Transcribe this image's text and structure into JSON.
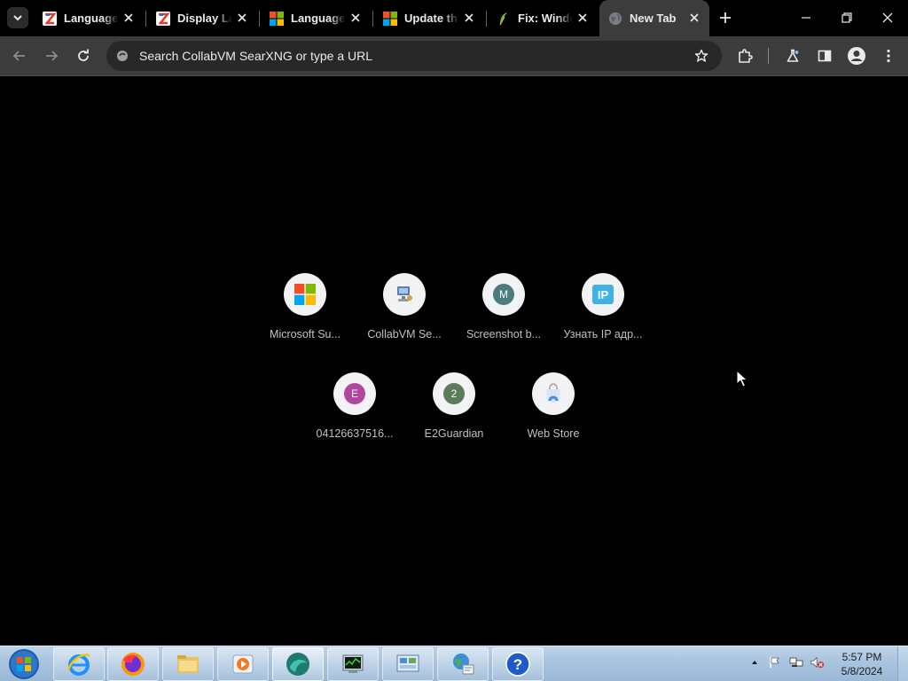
{
  "browser": {
    "tabs": [
      {
        "title": "Language",
        "icon": "zscaler-icon",
        "active": false
      },
      {
        "title": "Display La",
        "icon": "zscaler-icon",
        "active": false
      },
      {
        "title": "Language",
        "icon": "microsoft-icon",
        "active": false
      },
      {
        "title": "Update th",
        "icon": "microsoft-icon",
        "active": false
      },
      {
        "title": "Fix: Windo",
        "icon": "feather-icon",
        "active": false
      },
      {
        "title": "New Tab",
        "icon": "globe-icon",
        "active": true
      }
    ],
    "omnibox": {
      "placeholder": "Search CollabVM SearXNG or type a URL"
    }
  },
  "shortcuts": [
    {
      "label": "Microsoft Su...",
      "icon": "microsoft-logo-icon"
    },
    {
      "label": "CollabVM Se...",
      "icon": "collabvm-icon"
    },
    {
      "label": "Screenshot b...",
      "icon": "letter-m-icon",
      "letter": "M",
      "color": "#4a7c7e"
    },
    {
      "label": "Узнать IP адр...",
      "icon": "ip-icon",
      "letter": "IP",
      "color": "#3fb3e6"
    },
    {
      "label": "04126637516...",
      "icon": "letter-e-icon",
      "letter": "E",
      "color": "#b0479c"
    },
    {
      "label": "E2Guardian",
      "icon": "letter-2-icon",
      "letter": "2",
      "color": "#5c7a5c"
    },
    {
      "label": "Web Store",
      "icon": "web-store-icon"
    }
  ],
  "taskbar": {
    "apps": [
      "internet-explorer-icon",
      "firefox-icon",
      "file-explorer-icon",
      "media-player-icon",
      "chrome-like-icon",
      "task-manager-icon",
      "network-icon",
      "network-globe-icon",
      "help-icon"
    ],
    "clock": {
      "time": "5:57 PM",
      "date": "5/8/2024"
    }
  },
  "colors": {
    "tab_bar": "#000000",
    "toolbar": "#3c3c3c",
    "omnibox": "#282828",
    "text": "#e8eaed",
    "tile_bg": "#f1f3f4"
  }
}
